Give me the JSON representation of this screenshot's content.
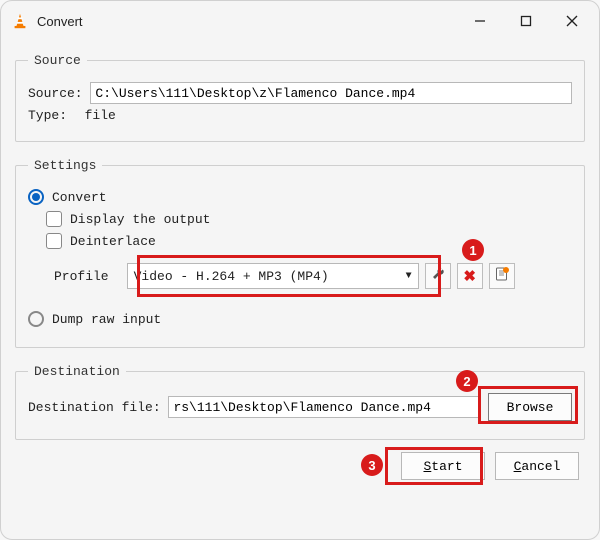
{
  "window": {
    "title": "Convert"
  },
  "source": {
    "legend": "Source",
    "label": "Source: ",
    "path": "C:\\Users\\111\\Desktop\\z\\Flamenco Dance.mp4",
    "type_label": "Type:  ",
    "type_value": "file"
  },
  "settings": {
    "legend": "Settings",
    "convert_label": "Convert",
    "display_output_label": "Display the output",
    "deinterlace_label": "Deinterlace",
    "profile_label": "Profile",
    "profile_value": "Video - H.264 + MP3 (MP4)",
    "dump_label": "Dump raw input"
  },
  "destination": {
    "legend": "Destination",
    "label": "Destination file: ",
    "path": "rs\\111\\Desktop\\Flamenco Dance.mp4",
    "browse_label": "Browse"
  },
  "buttons": {
    "start": "Start",
    "cancel": "Cancel"
  },
  "annotations": {
    "n1": "1",
    "n2": "2",
    "n3": "3"
  }
}
